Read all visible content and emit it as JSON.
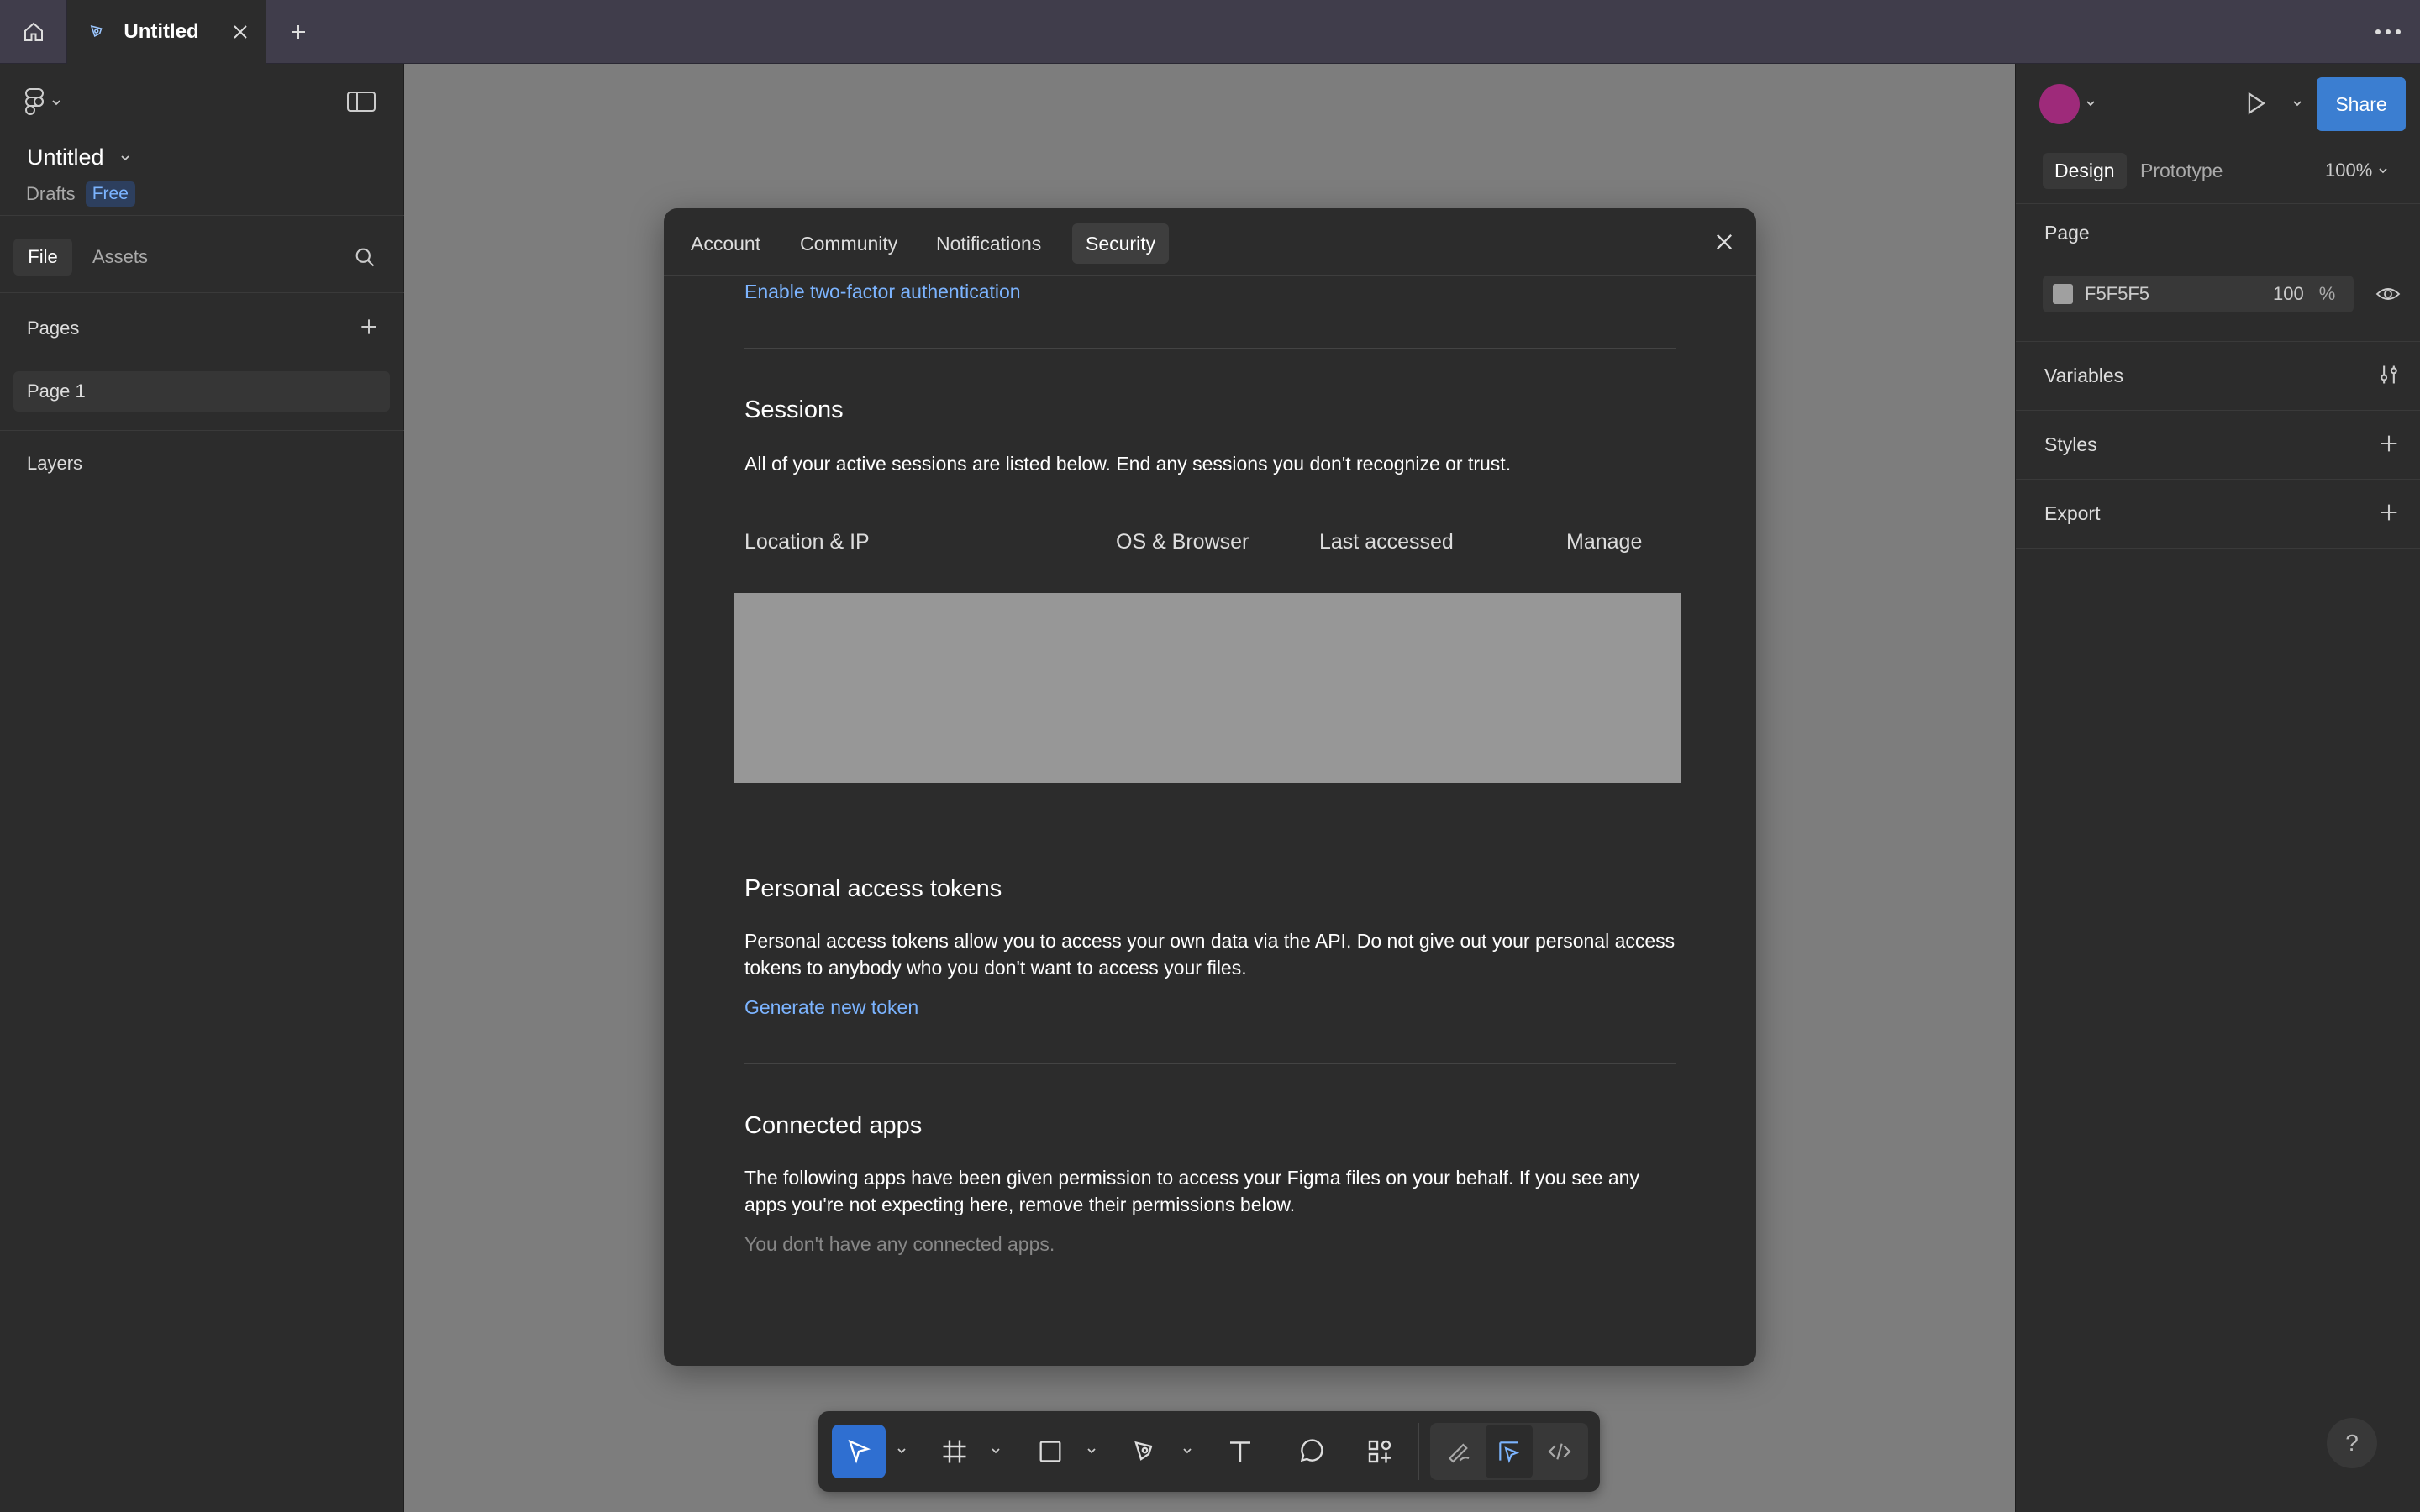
{
  "tabbar": {
    "tab_title": "Untitled"
  },
  "left_panel": {
    "file_title": "Untitled",
    "drafts_label": "Drafts",
    "plan_badge": "Free",
    "tabs": {
      "file": "File",
      "assets": "Assets"
    },
    "pages_heading": "Pages",
    "pages": [
      {
        "label": "Page 1"
      }
    ],
    "layers_heading": "Layers"
  },
  "right_panel": {
    "share_label": "Share",
    "tabs": {
      "design": "Design",
      "prototype": "Prototype"
    },
    "zoom": "100%",
    "page_heading": "Page",
    "page_color_hex": "F5F5F5",
    "page_color_opacity": "100",
    "page_color_pct": "%",
    "variables_heading": "Variables",
    "styles_heading": "Styles",
    "export_heading": "Export",
    "help_label": "?"
  },
  "modal": {
    "tabs": [
      "Account",
      "Community",
      "Notifications",
      "Security"
    ],
    "active_tab": "Security",
    "two_factor_link": "Enable two-factor authentication",
    "sessions": {
      "heading": "Sessions",
      "description": "All of your active sessions are listed below. End any sessions you don't recognize or trust.",
      "columns": [
        "Location & IP",
        "OS & Browser",
        "Last accessed",
        "Manage"
      ]
    },
    "tokens": {
      "heading": "Personal access tokens",
      "description": "Personal access tokens allow you to access your own data via the API. Do not give out your personal access tokens to anybody who you don't want to access your files.",
      "generate_link": "Generate new token"
    },
    "connected_apps": {
      "heading": "Connected apps",
      "description": "The following apps have been given permission to access your Figma files on your behalf. If you see any apps you're not expecting here, remove their permissions below.",
      "empty_text": "You don't have any connected apps."
    }
  },
  "colors": {
    "accent": "#3b7ed1",
    "link": "#7cb4ff",
    "canvas": "#7d7d7d",
    "panel": "#2c2c2c",
    "avatar": "#9e2a7a"
  }
}
